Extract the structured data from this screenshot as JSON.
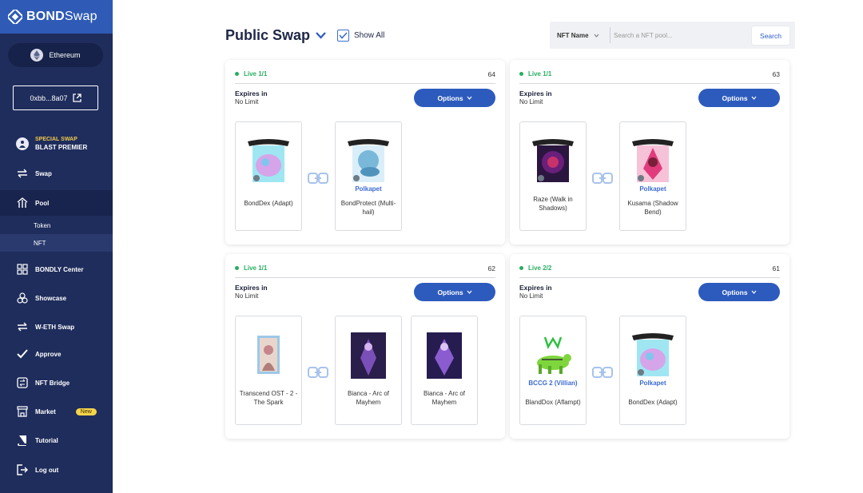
{
  "brand": {
    "prefix": "BOND",
    "suffix": "Swap"
  },
  "network": {
    "label": "Ethereum",
    "icon": "ethereum-icon"
  },
  "wallet": {
    "label": "0xbb...8a07",
    "icon": "external-link-icon"
  },
  "special": {
    "line1": "SPECIAL SWAP",
    "line2": "BLAST PREMIER"
  },
  "nav": [
    {
      "label": "Swap",
      "icon": "swap-arrows-icon"
    },
    {
      "label": "Pool",
      "icon": "pool-icon"
    },
    {
      "label": "BONDLY Center",
      "icon": "grid-icon"
    },
    {
      "label": "Showcase",
      "icon": "showcase-icon"
    },
    {
      "label": "W-ETH Swap",
      "icon": "swap-arrows-icon"
    },
    {
      "label": "Approve",
      "icon": "check-icon"
    },
    {
      "label": "NFT Bridge",
      "icon": "bridge-icon"
    },
    {
      "label": "Market",
      "icon": "market-icon",
      "badge": "New"
    },
    {
      "label": "Tutorial",
      "icon": "book-icon"
    },
    {
      "label": "Log out",
      "icon": "logout-icon"
    }
  ],
  "pool_sub": [
    {
      "label": "Token"
    },
    {
      "label": "NFT"
    }
  ],
  "header": {
    "title": "Public Swap",
    "show_all": "Show All"
  },
  "search": {
    "filter": "NFT Name",
    "placeholder": "Search a NFT pool...",
    "button": "Search"
  },
  "cards": [
    {
      "status": "Live 1/1",
      "number": "64",
      "expires_label": "Expires in",
      "expires_value": "No Limit",
      "options": "Options",
      "items": [
        {
          "collection": "",
          "name": "BondDex (Adapt)"
        },
        {
          "collection": "Polkapet",
          "name": "BondProtect (Multi-hail)"
        }
      ]
    },
    {
      "status": "Live 1/1",
      "number": "63",
      "expires_label": "Expires in",
      "expires_value": "No Limit",
      "options": "Options",
      "items": [
        {
          "collection": "",
          "name": "Raze (Walk in Shadows)"
        },
        {
          "collection": "Polkapet",
          "name": "Kusama (Shadow Bend)"
        }
      ]
    },
    {
      "status": "Live 1/1",
      "number": "62",
      "expires_label": "Expires in",
      "expires_value": "No Limit",
      "options": "Options",
      "items": [
        {
          "collection": "",
          "name": "Transcend OST - 2 - The Spark"
        },
        {
          "collection": "",
          "name": "Bianca - Arc of Mayhem"
        },
        {
          "collection": "",
          "name": "Bianca - Arc of Mayhem"
        }
      ]
    },
    {
      "status": "Live 2/2",
      "number": "61",
      "expires_label": "Expires in",
      "expires_value": "No Limit",
      "options": "Options",
      "items": [
        {
          "collection": "BCCG 2 (Villian)",
          "name": "BlandDox (Aflampt)"
        },
        {
          "collection": "Polkapet",
          "name": "BondDex (Adapt)"
        }
      ]
    }
  ],
  "colors": {
    "sidebar": "#1f2d5c",
    "brand_bar": "#2f5bb7",
    "accent": "#2d5bbd",
    "live": "#27ae60",
    "badge": "#f6d34a"
  }
}
